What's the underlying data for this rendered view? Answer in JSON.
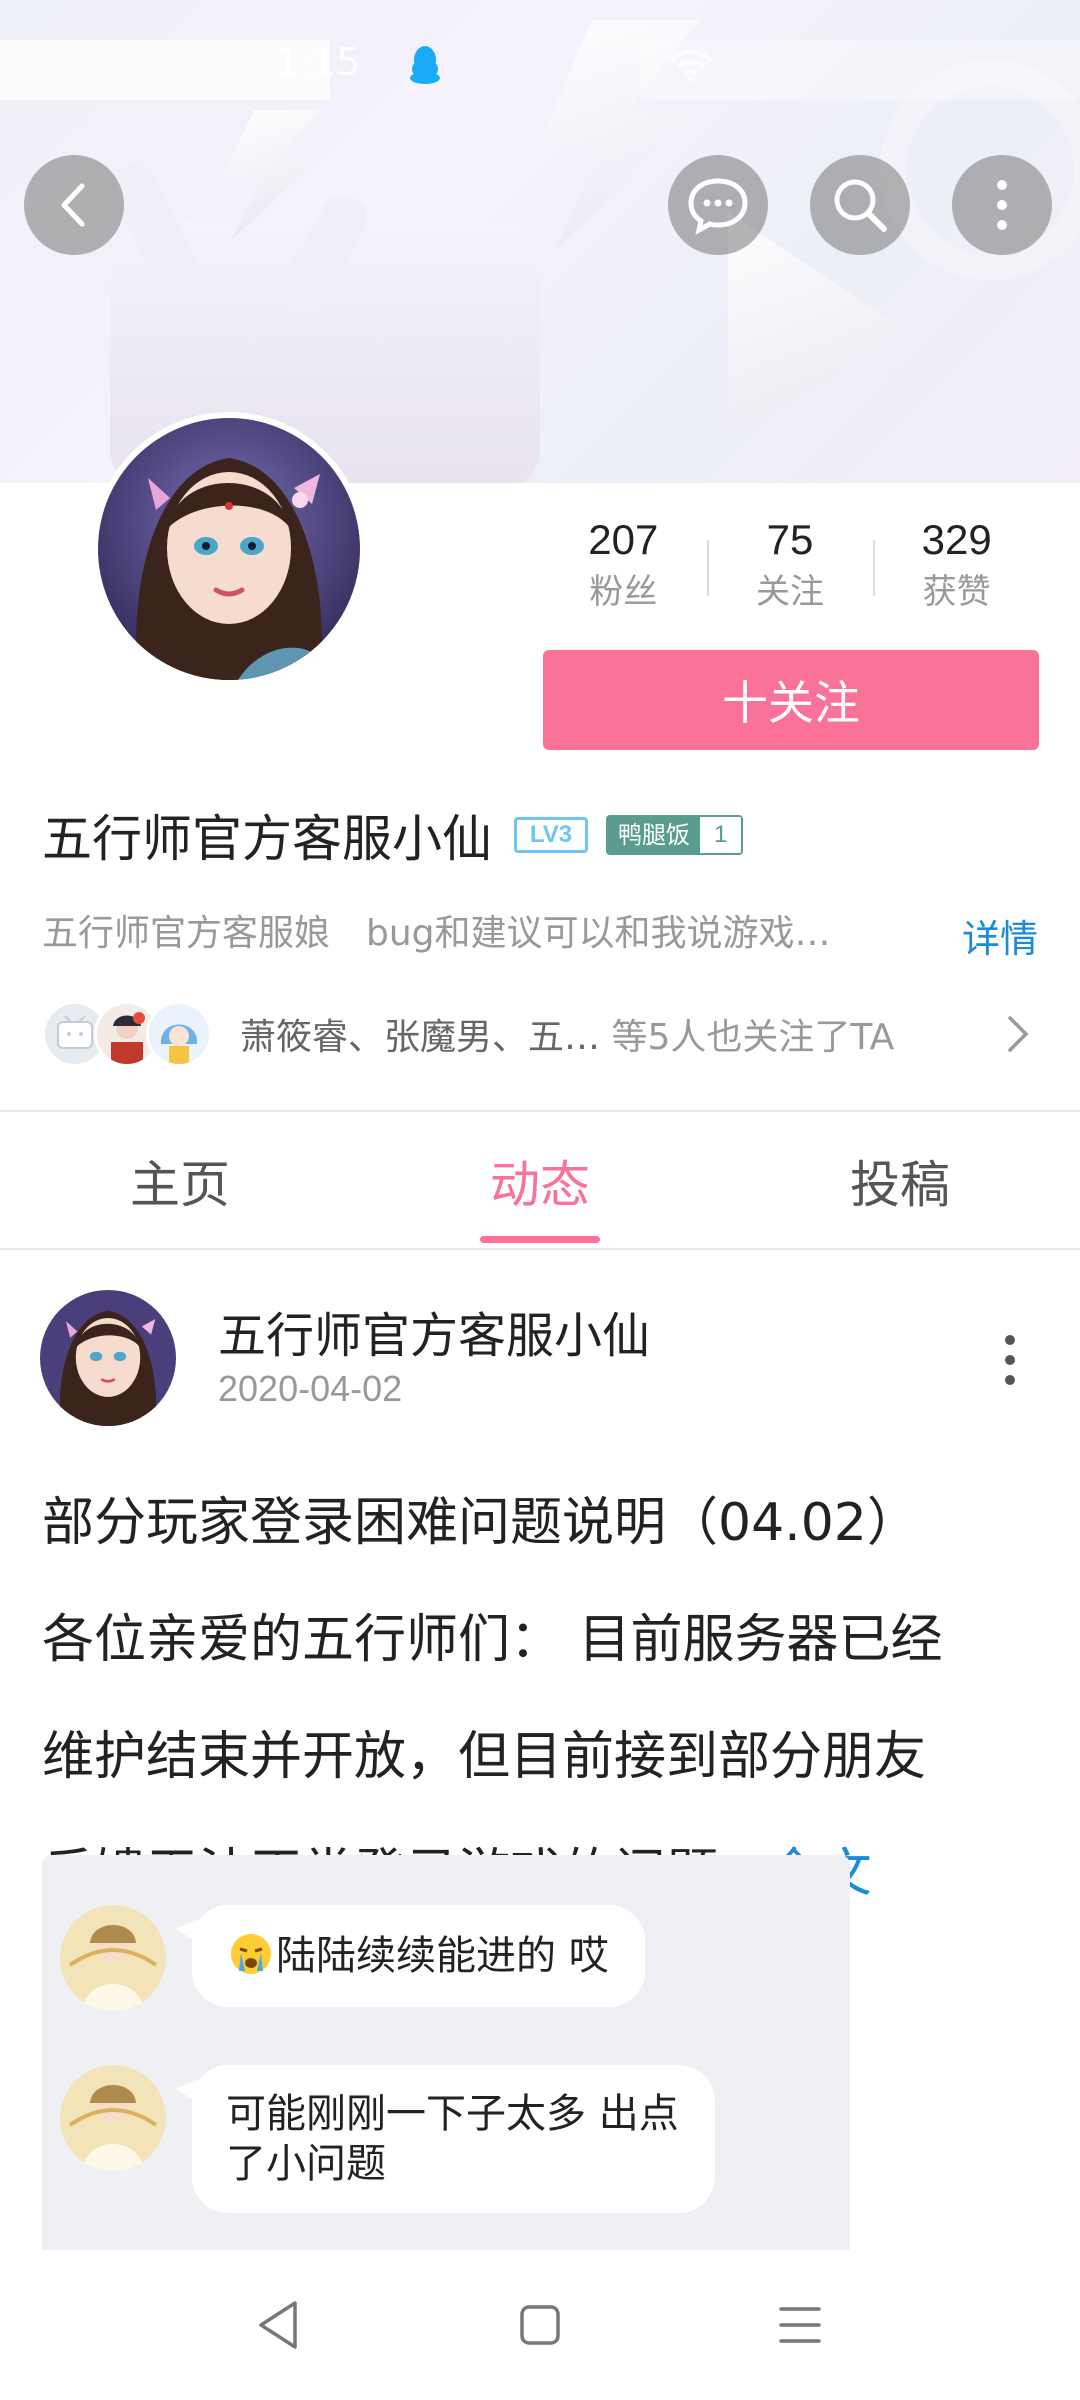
{
  "status_bar": {
    "time": "1:15"
  },
  "header": {
    "back_icon": "chevron-left-icon",
    "message_icon": "chat-bubble-icon",
    "search_icon": "search-icon",
    "more_icon": "more-vertical-icon"
  },
  "profile": {
    "stats": [
      {
        "value": "207",
        "label": "粉丝"
      },
      {
        "value": "75",
        "label": "关注"
      },
      {
        "value": "329",
        "label": "获赞"
      }
    ],
    "follow_button": "十关注",
    "name": "五行师官方客服小仙",
    "level_badge": "LV3",
    "fan_badge_name": "鸭腿饭",
    "fan_badge_level": "1",
    "sign": "五行师官方客服娘　bug和建议可以和我说游戏…",
    "detail_link": "详情",
    "mutual_followers": "萧筱睿、张魔男、五…",
    "mutual_suffix": "等5人也关注了TA"
  },
  "tabs": [
    {
      "label": "主页",
      "active": false
    },
    {
      "label": "动态",
      "active": true
    },
    {
      "label": "投稿",
      "active": false
    }
  ],
  "post": {
    "author": "五行师官方客服小仙",
    "date": "2020-04-02",
    "lines": [
      "部分玩家登录困难问题说明（04.02）",
      "各位亲爱的五行师们： 目前服务器已经",
      "维护结束并开放，但目前接到部分朋友",
      "反馈无法正常登录游戏的问题..."
    ],
    "full_text_link": "全文",
    "chat": [
      {
        "text": "陆陆续续能进的 哎",
        "has_emoji": true
      },
      {
        "text_lines": [
          "可能刚刚一下子太多 出点",
          "了小问题"
        ]
      }
    ]
  },
  "colors": {
    "accent_pink": "#fb7299",
    "link_blue": "#1a8bd6",
    "level_blue": "#6ec6f0",
    "fan_badge_green": "#5a9c8e"
  }
}
